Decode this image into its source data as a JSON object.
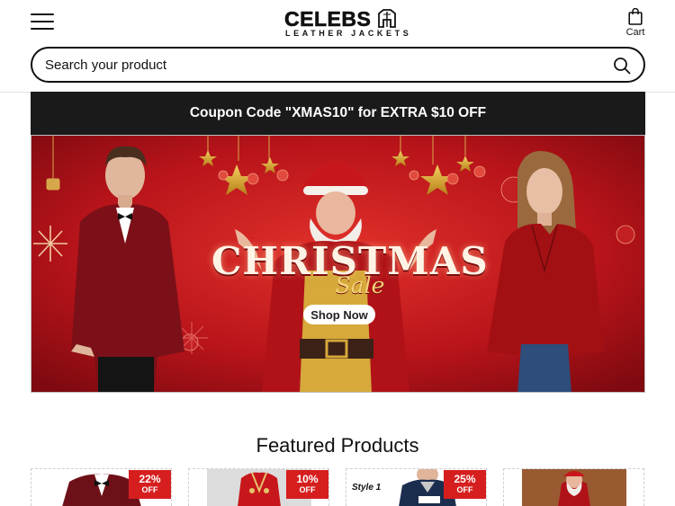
{
  "header": {
    "menu_icon": "hamburger-menu-icon",
    "logo": {
      "main": "CELEBS",
      "sub": "LEATHER JACKETS",
      "icon": "leather-jacket-icon"
    },
    "cart": {
      "label": "Cart",
      "icon": "shopping-bag-icon"
    }
  },
  "search": {
    "placeholder": "Search your product",
    "value": "",
    "icon": "search-icon"
  },
  "coupon": {
    "text": "Coupon Code \"XMAS10\" for EXTRA $10 OFF"
  },
  "banner": {
    "title": "CHRISTMAS",
    "subtitle": "Sale",
    "button": "Shop Now"
  },
  "colors": {
    "banner_red": "#c8171c",
    "coupon_bg": "#1a1a1a",
    "badge_red": "#d61e1e"
  },
  "featured": {
    "title": "Featured Products",
    "products": [
      {
        "discount": "22%",
        "off_label": "OFF",
        "image": "red-velvet-tuxedo-blazer"
      },
      {
        "discount": "10%",
        "off_label": "OFF",
        "image": "red-embroidered-vest"
      },
      {
        "discount": "25%",
        "off_label": "OFF",
        "image": "dallas-varsity-jacket",
        "style_label": "Style 1"
      },
      {
        "image": "santa-costume"
      }
    ]
  }
}
